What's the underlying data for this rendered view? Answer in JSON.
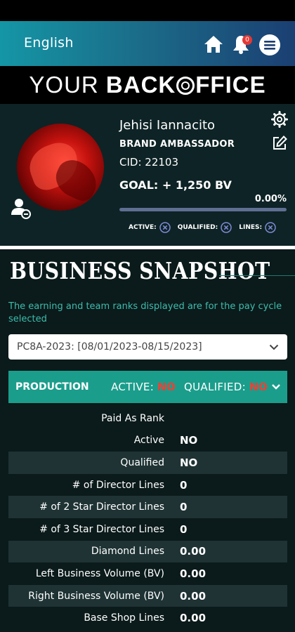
{
  "header": {
    "language": "English",
    "notification_count": "0"
  },
  "brand": {
    "part1": "YOUR ",
    "part2": "BACK",
    "part3": "FFICE"
  },
  "profile": {
    "name": "Jehisi Iannacito",
    "role": "BRAND AMBASSADOR",
    "cid": "CID: 22103",
    "goal": "GOAL: + 1,250 BV",
    "progress_text": "0.00%",
    "progress_value": 0,
    "flags": [
      {
        "label": "ACTIVE:"
      },
      {
        "label": "QUALIFIED:"
      },
      {
        "label": "LINES:"
      }
    ]
  },
  "snapshot": {
    "title": "BUSINESS SNAPSHOT",
    "description": "The earning and team ranks displayed are for the pay cycle selected",
    "period": "PC8A-2023: [08/01/2023-08/15/2023]"
  },
  "production": {
    "label": "PRODUCTION",
    "active_label": "ACTIVE:",
    "active_value": "NO",
    "qualified_label": "QUALIFIED:",
    "qualified_value": "NO"
  },
  "rows": [
    {
      "key": "Paid As Rank",
      "value": ""
    },
    {
      "key": "Active",
      "value": "NO"
    },
    {
      "key": "Qualified",
      "value": "NO"
    },
    {
      "key": "# of Director Lines",
      "value": "0"
    },
    {
      "key": "# of 2 Star Director Lines",
      "value": "0"
    },
    {
      "key": "# of 3 Star Director Lines",
      "value": "0"
    },
    {
      "key": "Diamond Lines",
      "value": "0.00"
    },
    {
      "key": "Left Business Volume (BV)",
      "value": "0.00"
    },
    {
      "key": "Right Business Volume (BV)",
      "value": "0.00"
    },
    {
      "key": "Base Shop Lines",
      "value": "0.00"
    }
  ],
  "colors": {
    "accent": "#1b9d8c",
    "text_teal": "#3dbdae",
    "negative": "#ff3b30"
  }
}
